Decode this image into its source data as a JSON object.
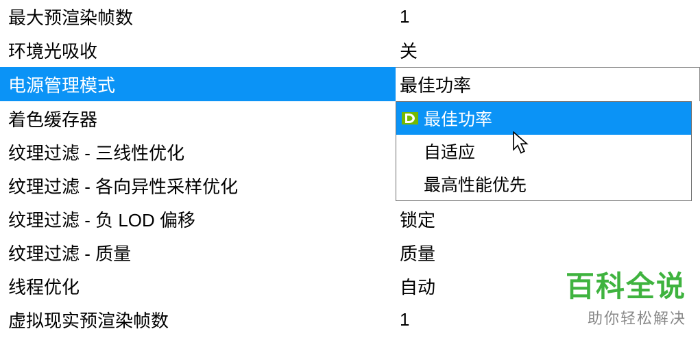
{
  "rows": [
    {
      "label": "最大预渲染帧数",
      "value": "1"
    },
    {
      "label": "环境光吸收",
      "value": "关"
    },
    {
      "label": "电源管理模式",
      "value": "最佳功率",
      "selected": true
    },
    {
      "label": "着色缓存器",
      "value": ""
    },
    {
      "label": "纹理过滤 - 三线性优化",
      "value": ""
    },
    {
      "label": "纹理过滤 - 各向异性采样优化",
      "value": ""
    },
    {
      "label": "纹理过滤 - 负 LOD 偏移",
      "value": "锁定"
    },
    {
      "label": "纹理过滤 - 质量",
      "value": "质量"
    },
    {
      "label": "线程优化",
      "value": "自动"
    },
    {
      "label": "虚拟现实预渲染帧数",
      "value": "1"
    }
  ],
  "dropdown": {
    "options": [
      {
        "label": "最佳功率",
        "selected": true,
        "icon": "nvidia"
      },
      {
        "label": "自适应"
      },
      {
        "label": "最高性能优先"
      }
    ]
  },
  "watermark": {
    "title": "百科全说",
    "subtitle": "助你轻松解决"
  }
}
